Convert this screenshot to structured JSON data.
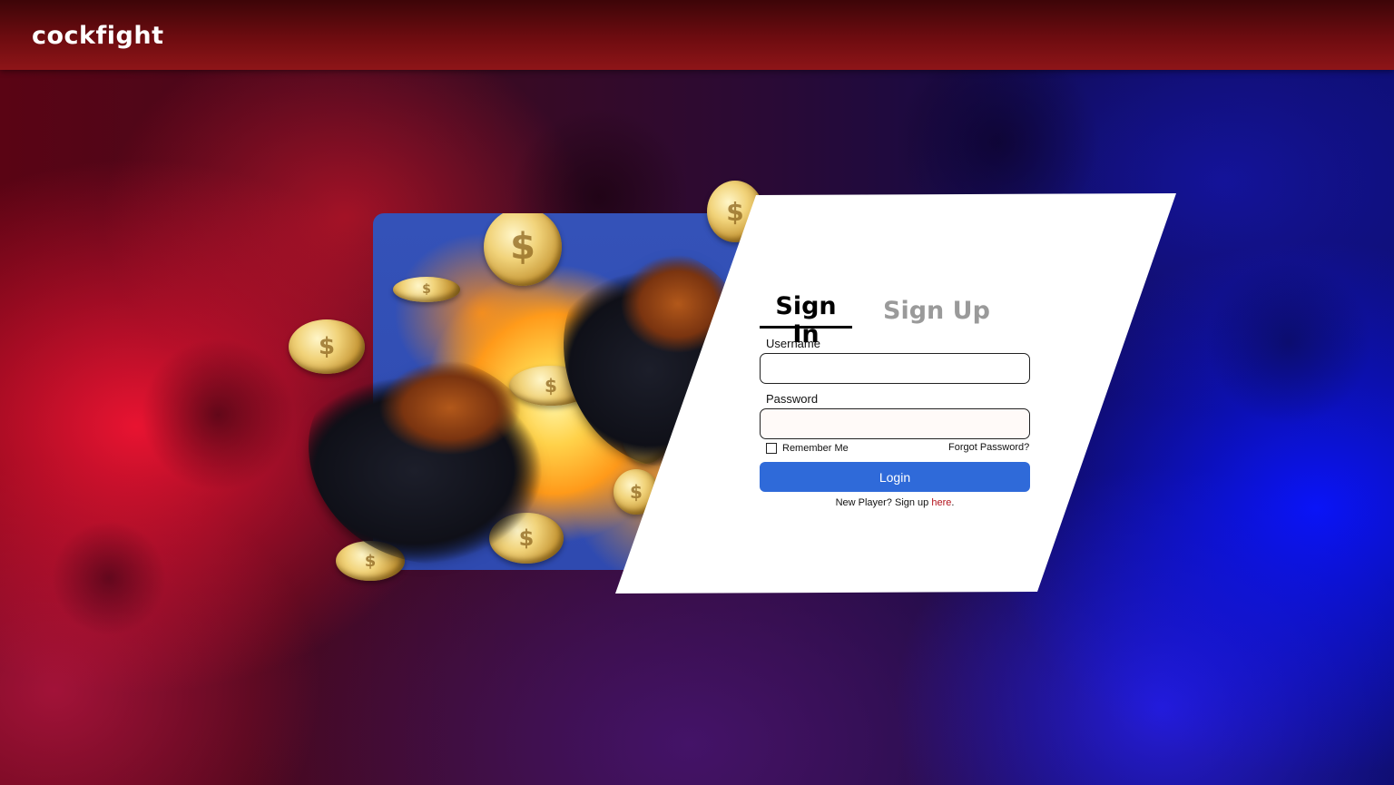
{
  "header": {
    "logo_text": "cockfight"
  },
  "hero": {
    "coin_symbol": "$"
  },
  "auth": {
    "tabs": [
      {
        "label": "Sign In",
        "active": true
      },
      {
        "label": "Sign Up",
        "active": false
      }
    ],
    "username_label": "Username",
    "username_value": "",
    "password_label": "Password",
    "password_value": "",
    "remember_label": "Remember Me",
    "remember_checked": false,
    "forgot_label": "Forgot Password?",
    "login_label": "Login",
    "newplayer_prefix": "New Player? Sign up ",
    "newplayer_link": "here",
    "newplayer_suffix": "."
  },
  "colors": {
    "header": "#8e1518",
    "login_button": "#2f6ad9",
    "link": "#b3121c",
    "tab_inactive": "#9a9a9a"
  }
}
